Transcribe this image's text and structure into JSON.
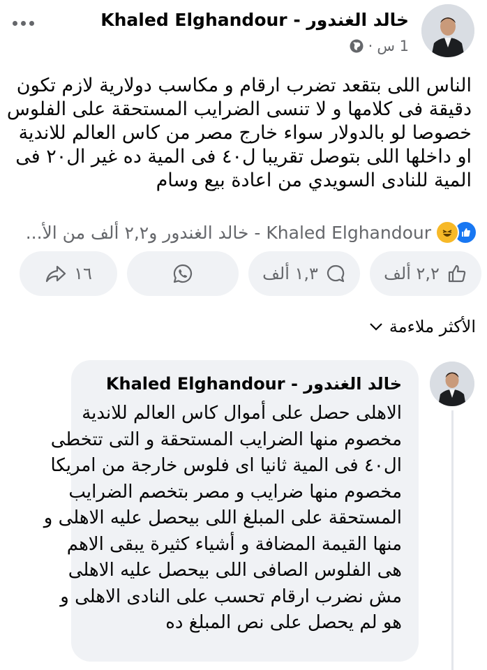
{
  "post": {
    "author": "خالد الغندور - Khaled Elghandour",
    "time": "1 س",
    "separator": "·",
    "text_lines": [
      "الناس اللى بتقعد تضرب ارقام و مكاسب دولارية لازم تكون",
      "دقيقة فى كلامها و لا تنسى الضرايب المستحقة على الفلوس",
      "خصوصا لو بالدولار سواء خارج مصر من كاس العالم للاندية",
      "او داخلها  اللى بتوصل تقريبا ل٤٠ فى المية ده غير ال٢٠ فى",
      "المية للنادى السويدي من اعادة  بيع وسام"
    ],
    "reactions_summary": "Khaled Elghandour - خالد الغندور و٢,٢ ألف من الأ..."
  },
  "actions": {
    "like_count": "٢,٢ ألف",
    "comment_count": "١,٣ ألف",
    "share_count": "١٦"
  },
  "sort_label": "الأكثر ملاءمة",
  "comment": {
    "author": "خالد الغندور - Khaled Elghandour",
    "text_lines": [
      "الاهلى حصل على أموال كاس العالم للاندية",
      "مخصوم منها الضرايب المستحقة و التى تتخطى",
      "ال٤٠ فى المية ثانيا اى فلوس خارجة من امريكا",
      "مخصوم منها ضرايب و مصر بتخصم الضرايب",
      "المستحقة على المبلغ اللى بيحصل عليه الاهلى و",
      "منها القيمة المضافة و أشياء كثيرة يبقى الاهم",
      "هى الفلوس الصافى اللى بيحصل عليه الاهلى",
      "مش نضرب ارقام تحسب على النادى الاهلى و",
      "هو لم يحصل على نص المبلغ ده"
    ]
  },
  "colors": {
    "facebook_blue": "#1877f2",
    "secondary_text": "#65676b",
    "bubble_bg": "#f0f2f5"
  }
}
